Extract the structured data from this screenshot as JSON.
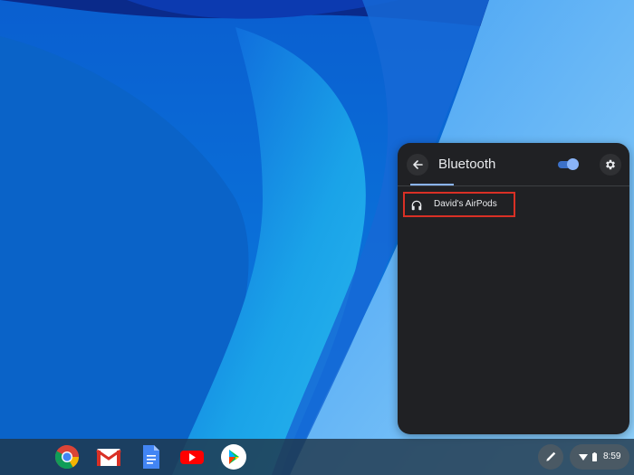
{
  "bluetooth_panel": {
    "title": "Bluetooth",
    "toggle_on": true,
    "devices": [
      {
        "name": "David's AirPods",
        "icon": "headphones-icon"
      }
    ]
  },
  "shelf": {
    "apps": [
      {
        "name": "Chrome",
        "icon": "chrome-icon"
      },
      {
        "name": "Gmail",
        "icon": "gmail-icon"
      },
      {
        "name": "Docs",
        "icon": "docs-icon"
      },
      {
        "name": "YouTube",
        "icon": "youtube-icon"
      },
      {
        "name": "Play Store",
        "icon": "play-store-icon"
      }
    ],
    "status": {
      "time": "8:59",
      "icons": [
        "wifi-icon",
        "battery-icon"
      ]
    },
    "stylus_icon": "stylus-icon"
  },
  "colors": {
    "panel_bg": "#202124",
    "accent": "#8ab4f8",
    "highlight_border": "#d93025"
  }
}
